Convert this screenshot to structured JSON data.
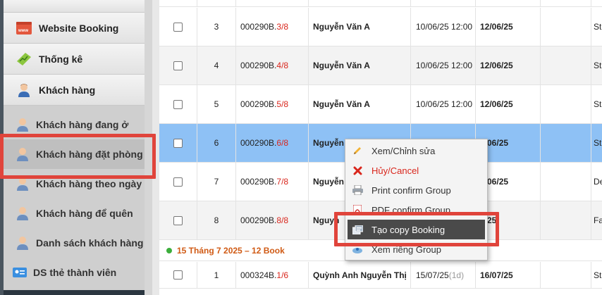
{
  "sidebar": {
    "top_items": [
      {
        "label": "Website Booking",
        "icon": "website-icon"
      },
      {
        "label": "Thống kê",
        "icon": "chart-icon"
      },
      {
        "label": "Khách hàng",
        "icon": "customer-icon"
      }
    ],
    "sub_items": [
      {
        "label": "Khách hàng đang ở",
        "icon": "user-icon"
      },
      {
        "label": "Khách hàng đặt phòng",
        "icon": "user-icon",
        "active": true
      },
      {
        "label": "Khách hàng theo ngày",
        "icon": "user-icon"
      },
      {
        "label": "Khách hàng để quên",
        "icon": "user-icon"
      },
      {
        "label": "Danh sách khách hàng",
        "icon": "user-icon"
      },
      {
        "label": "DS thẻ thành viên",
        "icon": "member-card-icon"
      }
    ]
  },
  "bookings": [
    {
      "num": "3",
      "code_prefix": "000290B.",
      "code_suffix": "3/8",
      "name": "Nguyễn Văn A",
      "checkin": "10/06/25 12:00",
      "checkout": "12/06/25",
      "last": "St"
    },
    {
      "num": "4",
      "code_prefix": "000290B.",
      "code_suffix": "4/8",
      "name": "Nguyễn Văn A",
      "checkin": "10/06/25 12:00",
      "checkout": "12/06/25",
      "last": "St"
    },
    {
      "num": "5",
      "code_prefix": "000290B.",
      "code_suffix": "5/8",
      "name": "Nguyễn Văn A",
      "checkin": "10/06/25 12:00",
      "checkout": "12/06/25",
      "last": "St"
    },
    {
      "num": "6",
      "code_prefix": "000290B.",
      "code_suffix": "6/8",
      "name": "Nguyễn",
      "checkin": "",
      "checkout": "2/06/25",
      "last": "St"
    },
    {
      "num": "7",
      "code_prefix": "000290B.",
      "code_suffix": "7/8",
      "name": "Nguyễn",
      "checkin": "",
      "checkout": "2/06/25",
      "last": "De"
    },
    {
      "num": "8",
      "code_prefix": "000290B.",
      "code_suffix": "8/8",
      "name": "Nguyn",
      "checkin": "",
      "checkout": "6/25",
      "last": "Fa"
    }
  ],
  "group_header": "15 Tháng 7 2025 – 12 Book",
  "next_booking": {
    "num": "1",
    "code_prefix": "000324B.",
    "code_suffix": "1/6",
    "name": "Quỳnh Anh Nguyễn Thị",
    "checkin": "15/07/25",
    "checkin_note": "(1d)",
    "checkout": "16/07/25",
    "last": "St"
  },
  "context_menu": {
    "items": [
      {
        "label": "Xem/Chỉnh sửa",
        "icon": "pencil-icon"
      },
      {
        "label": "Hủy/Cancel",
        "icon": "cancel-x-icon"
      },
      {
        "label": "Print confirm Group",
        "icon": "printer-icon"
      },
      {
        "label": "PDF confirm Group",
        "icon": "pdf-icon"
      },
      {
        "label": "Tạo copy Booking",
        "icon": "copy-booking-icon"
      },
      {
        "label": "Xem riêng Group",
        "icon": "group-view-icon"
      }
    ]
  },
  "colors": {
    "selected_row": "#8ec1f5",
    "accent_red": "#d9261c",
    "highlight_box": "#e0443b",
    "group_header": "#d05a14"
  }
}
